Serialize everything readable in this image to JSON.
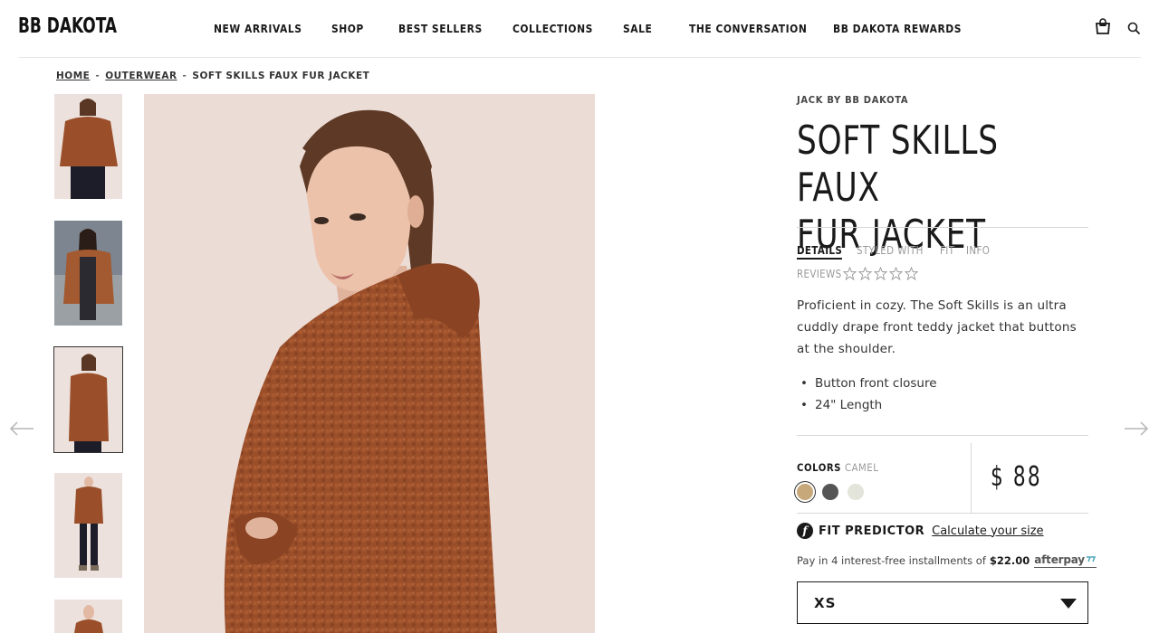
{
  "header": {
    "logo": "BB DAKOTA",
    "nav": [
      "NEW ARRIVALS",
      "SHOP",
      "BEST SELLERS",
      "COLLECTIONS",
      "SALE",
      "THE CONVERSATION",
      "BB DAKOTA REWARDS"
    ]
  },
  "breadcrumb": {
    "items": [
      "HOME",
      "OUTERWEAR",
      "SOFT SKILLS FAUX FUR JACKET"
    ],
    "separator": "-"
  },
  "product": {
    "brand": "JACK BY BB DAKOTA",
    "title_line1": "SOFT SKILLS FAUX",
    "title_line2": "FUR JACKET",
    "tabs": [
      "DETAILS",
      "STYLED WITH",
      "FIT",
      "INFO"
    ],
    "active_tab": "DETAILS",
    "reviews_label": "REVIEWS",
    "rating_filled": 0,
    "rating_max": 5,
    "description": "Proficient in cozy. The Soft Skills is an ultra cuddly drape front teddy jacket that buttons at the shoulder.",
    "bullets": [
      "Button front closure",
      "24\" Length"
    ],
    "colors_label": "COLORS",
    "selected_color": "CAMEL",
    "swatches": [
      {
        "name": "camel",
        "color": "#c7a87a"
      },
      {
        "name": "charcoal",
        "color": "#555555"
      },
      {
        "name": "cream",
        "color": "#e3e5da"
      }
    ],
    "price": "$ 88",
    "fit_predictor_label": "FIT PREDICTOR",
    "fit_predictor_link": "Calculate your size",
    "installments_text": "Pay in 4 interest-free installments of",
    "installment_amount": "$22.00",
    "afterpay_logo": "afterpay",
    "size_selected": "XS"
  },
  "gallery": {
    "thumbnail_count": 5,
    "active_thumbnail": 3
  },
  "colors": {
    "jacket": "#9a4f2a",
    "jacket_dark": "#7c3b1e",
    "backdrop": "#ecdcd6"
  }
}
